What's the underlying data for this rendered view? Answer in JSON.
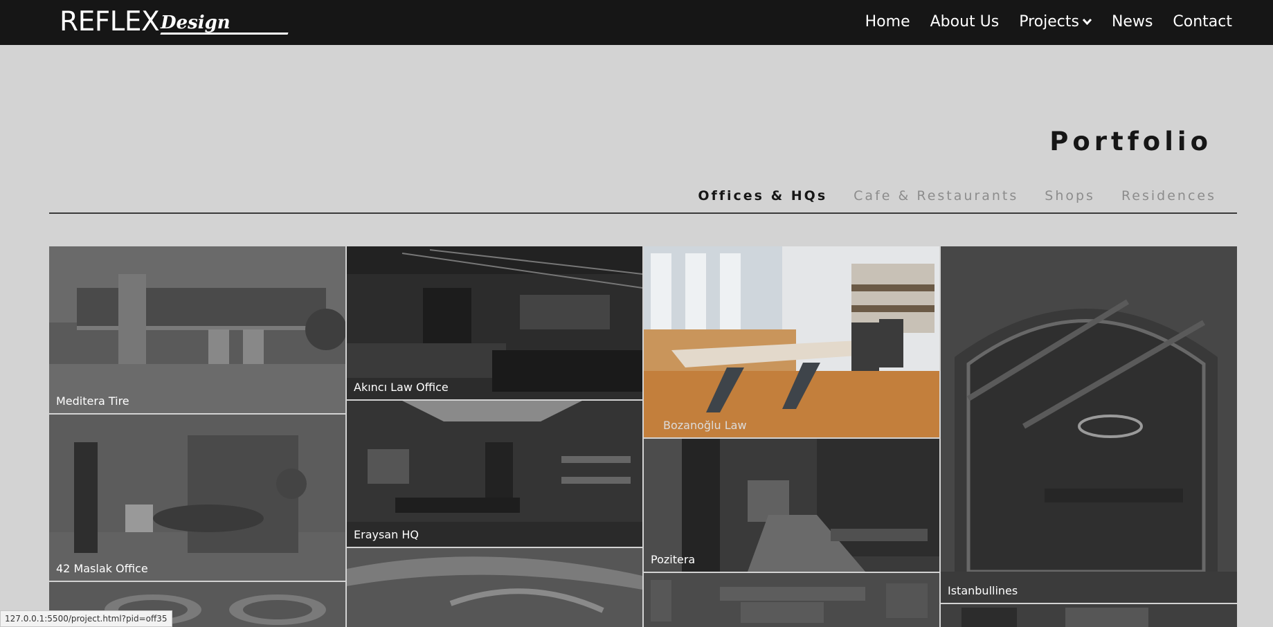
{
  "logo": {
    "primary": "REFLEX",
    "secondary": "Design"
  },
  "nav": {
    "home": "Home",
    "about": "About Us",
    "projects": "Projects",
    "news": "News",
    "contact": "Contact"
  },
  "page": {
    "title": "Portfolio"
  },
  "tabs": [
    {
      "label": "Offices & HQs",
      "active": true
    },
    {
      "label": "Cafe & Restaurants",
      "active": false
    },
    {
      "label": "Shops",
      "active": false
    },
    {
      "label": "Residences",
      "active": false
    }
  ],
  "projects": [
    {
      "caption": "Meditera Tire"
    },
    {
      "caption": "42 Maslak Office"
    },
    {
      "caption": ""
    },
    {
      "caption": "Akıncı Law Office"
    },
    {
      "caption": "Eraysan HQ"
    },
    {
      "caption": ""
    },
    {
      "caption": "Bozanoğlu Law"
    },
    {
      "caption": "Pozitera"
    },
    {
      "caption": ""
    },
    {
      "caption": "Istanbullines"
    },
    {
      "caption": ""
    }
  ],
  "status_bar": {
    "url": "127.0.0.1:5500/project.html?pid=off35"
  },
  "colors": {
    "header_bg": "#161616",
    "page_bg": "#d3d3d3",
    "active_tab": "#161616",
    "inactive_tab": "#8c8c8c"
  }
}
